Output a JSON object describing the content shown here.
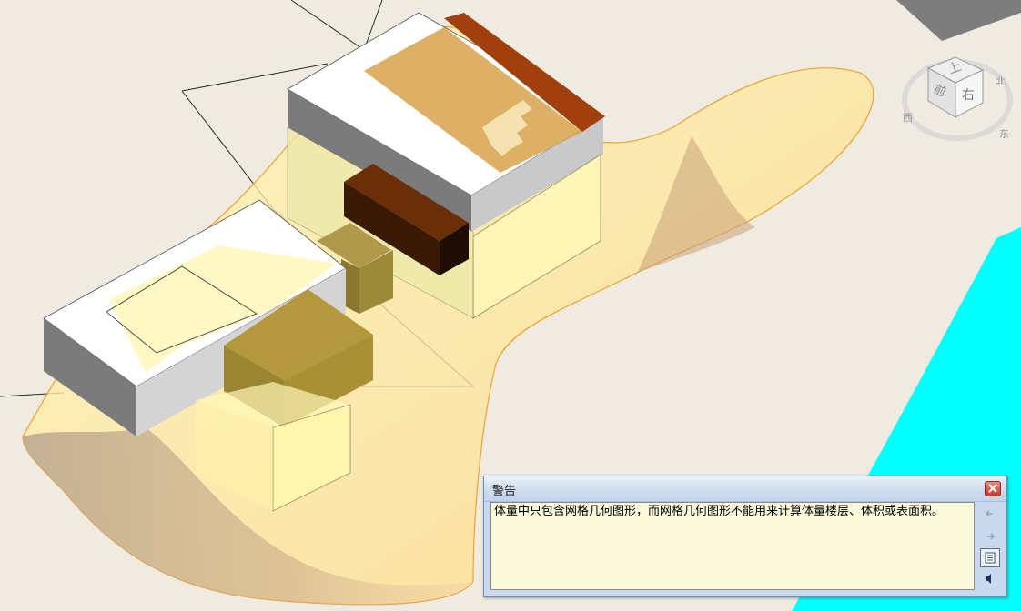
{
  "viewcube": {
    "face_top": "上",
    "face_left": "前",
    "face_right": "右",
    "compass_north": "北",
    "compass_east": "东",
    "compass_west": "西"
  },
  "warning_dialog": {
    "title": "警告",
    "message": "体量中只包含网格几何图形，而网格几何图形不能用来计算体量楼层、体积或表面积。"
  },
  "colors": {
    "background": "#efebe0",
    "water": "#00ffff",
    "mass_translucent": "#fff3a0",
    "mass_edge": "#f0a030",
    "roof_brown": "#a2400d",
    "dark_block": "#3a1a05",
    "dialog_body": "#fbf9dc"
  }
}
